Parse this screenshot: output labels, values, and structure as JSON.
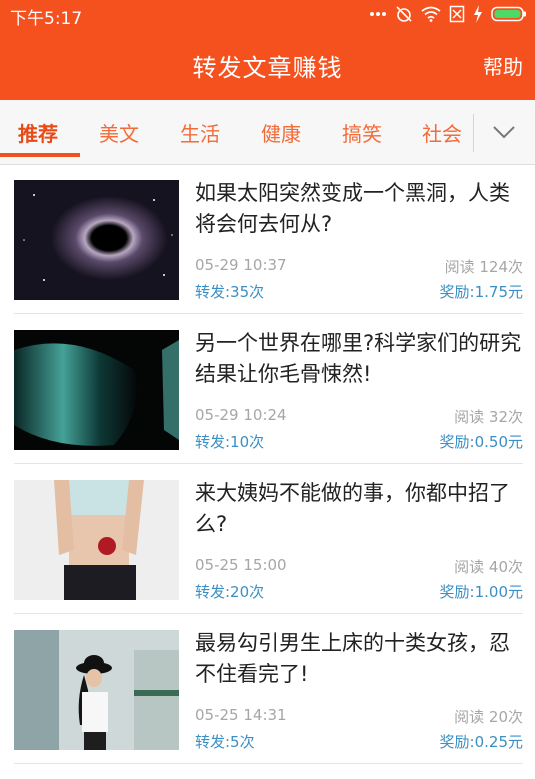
{
  "status_bar": {
    "time": "下午5:17",
    "icons": [
      "dots-icon",
      "alarm-off-icon",
      "wifi-icon",
      "sim-off-icon",
      "charging-icon",
      "battery-icon"
    ]
  },
  "header": {
    "title": "转发文章赚钱",
    "help_label": "帮助"
  },
  "tabs": [
    {
      "label": "推荐",
      "active": true
    },
    {
      "label": "美文",
      "active": false
    },
    {
      "label": "生活",
      "active": false
    },
    {
      "label": "健康",
      "active": false
    },
    {
      "label": "搞笑",
      "active": false
    },
    {
      "label": "社会",
      "active": false
    }
  ],
  "articles": [
    {
      "title": "如果太阳突然变成一个黑洞，人类将会何去何从?",
      "date": "05-29 10:37",
      "reads": "阅读 124次",
      "shares": "转发:35次",
      "reward": "奖励:1.75元",
      "thumb": "black-hole-image"
    },
    {
      "title": "另一个世界在哪里?科学家们的研究结果让你毛骨悚然!",
      "date": "05-29 10:24",
      "reads": "阅读 32次",
      "shares": "转发:10次",
      "reward": "奖励:0.50元",
      "thumb": "teal-nebula-image"
    },
    {
      "title": "来大姨妈不能做的事，你都中招了么?",
      "date": "05-25 15:00",
      "reads": "阅读 40次",
      "shares": "转发:20次",
      "reward": "奖励:1.00元",
      "thumb": "woman-apple-image"
    },
    {
      "title": "最易勾引男生上床的十类女孩，忍不住看完了!",
      "date": "05-25 14:31",
      "reads": "阅读 20次",
      "shares": "转发:5次",
      "reward": "奖励:0.25元",
      "thumb": "girl-hat-image"
    }
  ],
  "colors": {
    "brand": "#f4511e",
    "tab_text": "#f26b3a",
    "link_blue": "#3a8fc4",
    "meta_gray": "#a6a6a6"
  }
}
